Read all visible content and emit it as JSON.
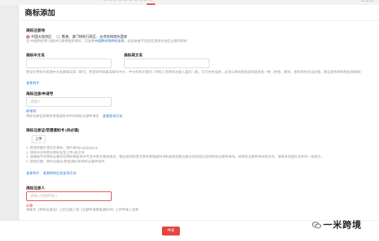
{
  "top_nav": {
    "items_text": "— — — — — — — — — —",
    "right_text": "— — —"
  },
  "page": {
    "title": "商标添加"
  },
  "region": {
    "label": "商标注册地",
    "options": [
      "中国大陆地区",
      "香港、澳门特别行政区、台湾省和境外国家"
    ],
    "selected_index": 0,
    "hint_before": "在“中国商标网”注册并已被受理的商标，可查看",
    "hint_link": "中国商标网商标查询",
    "hint_after": "，此处数据不包括在港澳台地区注册的商标"
  },
  "name_cn": {
    "label": "商标中文名",
    "value": ""
  },
  "name_en": {
    "label": "商标英文名",
    "value": ""
  },
  "name_hint": {
    "line1": "若设计商标文或者中文品牌填写其一即可。若您同时具备该填写中文，中文和英文需同一持有人且商标注册人是同一家，方可合并品牌。必须与商标网查询的品牌名一致（拼音、繁体、图形商标无法处理，建议提供",
    "line2": "商标网查询结果）",
    "example_link": "查看例子"
  },
  "reg_no": {
    "label": "商标注册/申请号",
    "placeholder": "请输入",
    "add_link": "新增项",
    "hint": "商标注册证和商标受理通知书中的商标注册申请号",
    "query_link": "查看查询方式"
  },
  "cert": {
    "label": "商标注册证/受理通知书 (非必填)",
    "upload_label": "上传",
    "notes": [
      "1. 若提供图片或优先审核，图片格式png/jpg/jpeg",
      "2. 持有中文和英文商标证至上传2张文件",
      "3. 请根据不同商标注册号在商标网查询中不全中英文审核情况，建议您同时提交商标受理通知书和具有完整注册号及商品信息的商标注册申请书，如商标注册申请书有多页，请将多页图片合并到一张提交。",
      "4. 范例示图：商标注册证/受理通知书/商标注册申请书"
    ],
    "example_link": "查看例子",
    "query_link": "查看商标信息查询方式"
  },
  "registrant": {
    "label": "商标注册人",
    "placeholder": "请输入商标所有人",
    "required_text": "必填",
    "hint": "请填写《商标注册证》上的注册人或《注册申请受理通知书》上的申请人名称"
  },
  "footer": {
    "submit_label": "申请"
  },
  "watermark": {
    "text": "一米跨境"
  },
  "colors": {
    "accent": "#e6453f",
    "link": "#2f7bd9",
    "hint": "#999999"
  }
}
